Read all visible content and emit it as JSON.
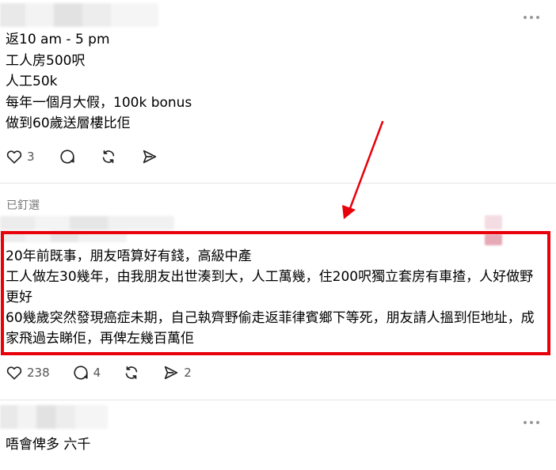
{
  "colors": {
    "arrow": "#e8000b",
    "highlight_border": "#e8000b",
    "icon": "#222222",
    "count_text": "#555555"
  },
  "post1": {
    "lines": "返10 am - 5 pm\n工人房500呎\n人工50k\n每年一個月大假，100k bonus\n做到60歲送層樓比佢",
    "like_count": "3",
    "icons": {
      "like": "heart-icon",
      "comment": "comment-icon",
      "repost": "repost-icon",
      "share": "share-icon",
      "more": "more-icon"
    }
  },
  "pinned_label": "已釘選",
  "comment": {
    "lines": "20年前既事，朋友唔算好有錢，高級中產\n工人做左30幾年，由我朋友出世湊到大，人工萬幾，住200呎獨立套房有車揸，人好做野更好\n60幾歲突然發現癌症未期，自己執齊野偷走返菲律賓鄉下等死，朋友請人搵到佢地址，成家飛過去睇佢，再俾左幾百萬佢",
    "like_count": "238",
    "comment_count": "4",
    "share_count": "2"
  },
  "reply": {
    "text": "唔會俾多 六千"
  }
}
